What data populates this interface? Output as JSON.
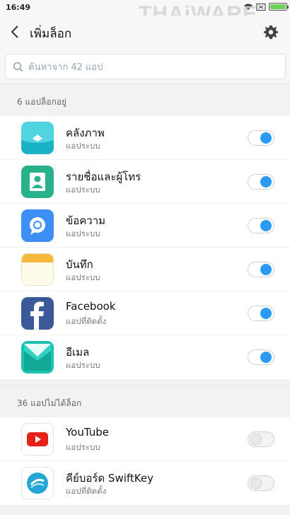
{
  "status_bar": {
    "time": "16:49"
  },
  "watermark": "THAiWARE",
  "app_bar": {
    "title": "เพิ่มล็อก"
  },
  "search": {
    "placeholder": "ค้นหาจาก 42 แอป"
  },
  "locked_section": {
    "header": "6 แอปล็อกอยู่",
    "items": [
      {
        "name": "คลังภาพ",
        "subtitle": "แอประบบ",
        "icon": "gallery-icon",
        "enabled": true
      },
      {
        "name": "รายชื่อและผู้โทร",
        "subtitle": "แอประบบ",
        "icon": "contacts-icon",
        "enabled": true
      },
      {
        "name": "ข้อความ",
        "subtitle": "แอประบบ",
        "icon": "messages-icon",
        "enabled": true
      },
      {
        "name": "บันทึก",
        "subtitle": "แอประบบ",
        "icon": "notes-icon",
        "enabled": true
      },
      {
        "name": "Facebook",
        "subtitle": "แอปที่ติดตั้ง",
        "icon": "facebook-icon",
        "enabled": true
      },
      {
        "name": "อีเมล",
        "subtitle": "แอประบบ",
        "icon": "email-icon",
        "enabled": true
      }
    ]
  },
  "unlocked_section": {
    "header": "36 แอปไม่ได้ล็อก",
    "items": [
      {
        "name": "YouTube",
        "subtitle": "แอประบบ",
        "icon": "youtube-icon",
        "enabled": false
      },
      {
        "name": "คีย์บอร์ด SwiftKey",
        "subtitle": "แอปที่ติดตั้ง",
        "icon": "swiftkey-icon",
        "enabled": false
      }
    ]
  },
  "colors": {
    "toggle_on": "#2b9af3",
    "gallery": "#31c8d6",
    "contacts": "#27b28c",
    "messages": "#3d8ff5",
    "notes": "#f7b93b",
    "facebook": "#3b5998",
    "email": "#1ec2b0",
    "youtube": "#e62117"
  }
}
